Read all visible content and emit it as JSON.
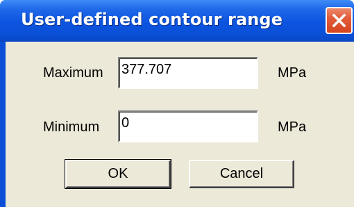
{
  "window": {
    "title": "User-defined contour range",
    "close_label": "close"
  },
  "form": {
    "maximum_label": "Maximum",
    "maximum_value": "377.707",
    "maximum_unit": "MPa",
    "minimum_label": "Minimum",
    "minimum_value": "0",
    "minimum_unit": "MPa"
  },
  "buttons": {
    "ok_label": "OK",
    "cancel_label": "Cancel"
  },
  "colors": {
    "titlebar": "#0a4fd6",
    "client_background": "#ece9d8",
    "close_button": "#e25c3a"
  },
  "icons": {
    "close": "close-icon"
  }
}
